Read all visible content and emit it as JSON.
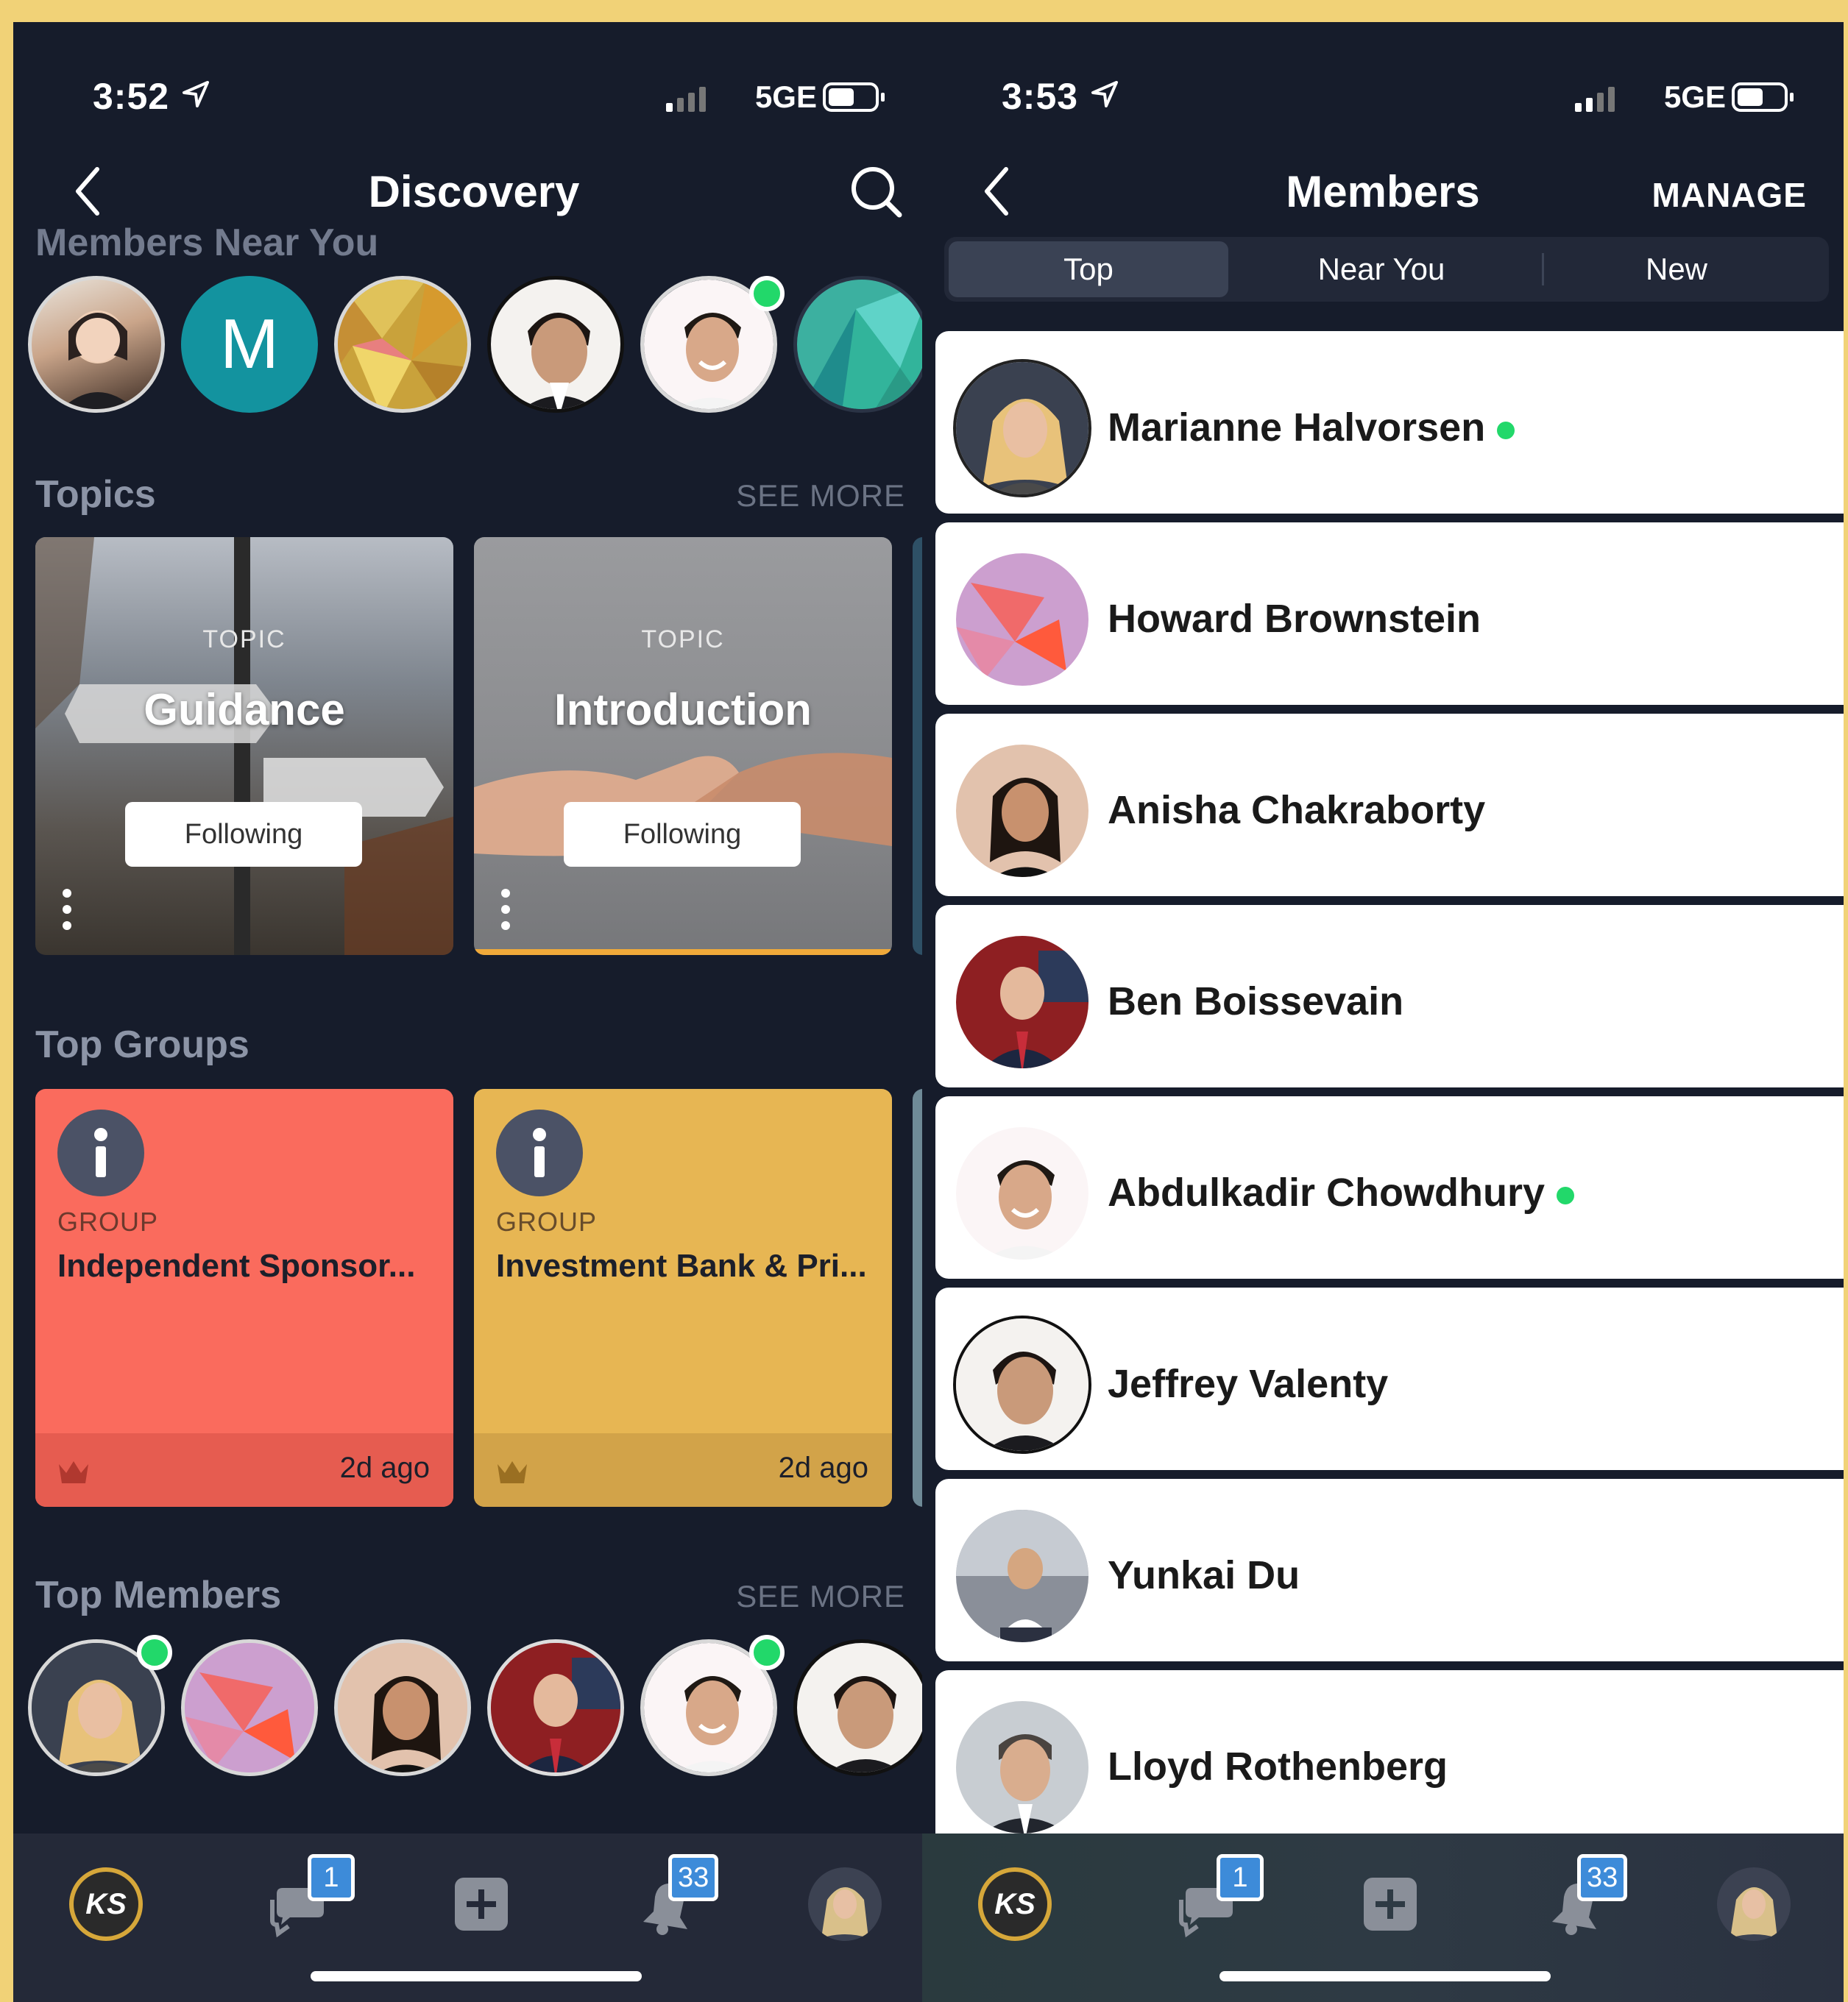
{
  "left": {
    "status": {
      "time": "3:52",
      "network": "5GE"
    },
    "header": {
      "title": "Discovery"
    },
    "near_you": {
      "title": "Members Near You",
      "avatar_letter": "M"
    },
    "topics": {
      "title": "Topics",
      "see_more": "SEE MORE",
      "cards": [
        {
          "label": "TOPIC",
          "name": "Guidance",
          "button": "Following"
        },
        {
          "label": "TOPIC",
          "name": "Introduction",
          "button": "Following"
        }
      ]
    },
    "groups": {
      "title": "Top Groups",
      "cards": [
        {
          "label": "GROUP",
          "name": "Independent Sponsor...",
          "ago": "2d ago",
          "color": "#fa6b5d"
        },
        {
          "label": "GROUP",
          "name": "Investment Bank & Pri...",
          "ago": "2d ago",
          "color": "#e7b653"
        }
      ]
    },
    "top_members": {
      "title": "Top Members",
      "see_more": "SEE MORE"
    },
    "tabbar": {
      "messages_badge": "1",
      "notifications_badge": "33",
      "logo_text": "KS"
    }
  },
  "right": {
    "status": {
      "time": "3:53",
      "network": "5GE"
    },
    "header": {
      "title": "Members",
      "manage": "MANAGE"
    },
    "tabs": [
      "Top",
      "Near You",
      "New"
    ],
    "members": [
      {
        "name": "Marianne Halvorsen",
        "online": true
      },
      {
        "name": "Howard Brownstein",
        "online": false
      },
      {
        "name": "Anisha Chakraborty",
        "online": false
      },
      {
        "name": "Ben Boissevain",
        "online": false
      },
      {
        "name": "Abdulkadir Chowdhury",
        "online": true
      },
      {
        "name": "Jeffrey Valenty",
        "online": false
      },
      {
        "name": "Yunkai Du",
        "online": false
      },
      {
        "name": "Lloyd Rothenberg",
        "online": false
      }
    ],
    "tabbar": {
      "messages_badge": "1",
      "notifications_badge": "33",
      "logo_text": "KS"
    }
  },
  "colors": {
    "background": "#161c2b",
    "online": "#22d86a",
    "badge": "#3d8bd9",
    "frame": "#f1d277"
  }
}
